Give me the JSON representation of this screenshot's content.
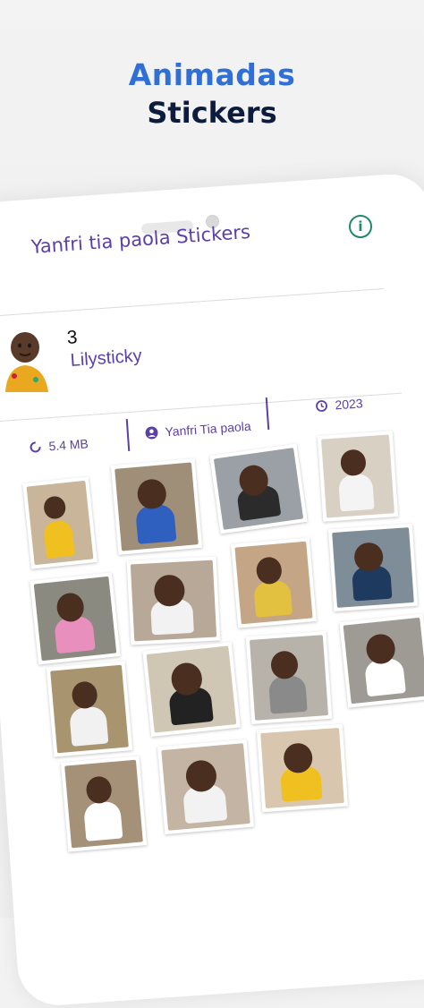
{
  "headline": {
    "line1": "Animadas",
    "line2": "Stickers"
  },
  "pack": {
    "title": "Yanfri tia paola Stickers",
    "count": "3",
    "author": "Lilysticky",
    "size": "5.4 MB",
    "publisher": "Yanfri Tia paola",
    "year": "2023"
  },
  "icons": {
    "info": "info-icon",
    "size": "progress-circle-icon",
    "publisher": "account-icon",
    "year": "clock-icon"
  },
  "colors": {
    "accent": "#5c3fa8",
    "headline_blue": "#2f6fd6",
    "headline_dark": "#0d1b3d",
    "info_green": "#1e8a6a"
  },
  "stickers": [
    {
      "label": "sticker-1",
      "bg": "#c9b59a",
      "shirt": "#f0c020"
    },
    {
      "label": "sticker-2",
      "bg": "#a08f78",
      "shirt": "#2f5fbf"
    },
    {
      "label": "sticker-3",
      "bg": "#9aa0a6",
      "shirt": "#2b2b2b"
    },
    {
      "label": "sticker-4",
      "bg": "#d9d0c4",
      "shirt": "#f4f4f4"
    },
    {
      "label": "sticker-5",
      "bg": "#8a8a80",
      "shirt": "#e98fbe"
    },
    {
      "label": "sticker-6",
      "bg": "#b8a898",
      "shirt": "#f2f2f2"
    },
    {
      "label": "sticker-7",
      "bg": "#c4a585",
      "shirt": "#e2c040"
    },
    {
      "label": "sticker-8",
      "bg": "#7f8d98",
      "shirt": "#1f3a5f"
    },
    {
      "label": "sticker-9",
      "bg": "#a89570",
      "shirt": "#f1f1f1"
    },
    {
      "label": "sticker-10",
      "bg": "#cfc6b4",
      "shirt": "#222222"
    },
    {
      "label": "sticker-11",
      "bg": "#b7b2aa",
      "shirt": "#8a8a8a"
    },
    {
      "label": "sticker-12",
      "bg": "#9e9a94",
      "shirt": "#ffffff"
    },
    {
      "label": "sticker-13",
      "bg": "#a59078",
      "shirt": "#ffffff"
    },
    {
      "label": "sticker-14",
      "bg": "#c3b4a4",
      "shirt": "#f2f2f2"
    },
    {
      "label": "sticker-15",
      "bg": "#d8c7ae",
      "shirt": "#f0c020"
    }
  ]
}
